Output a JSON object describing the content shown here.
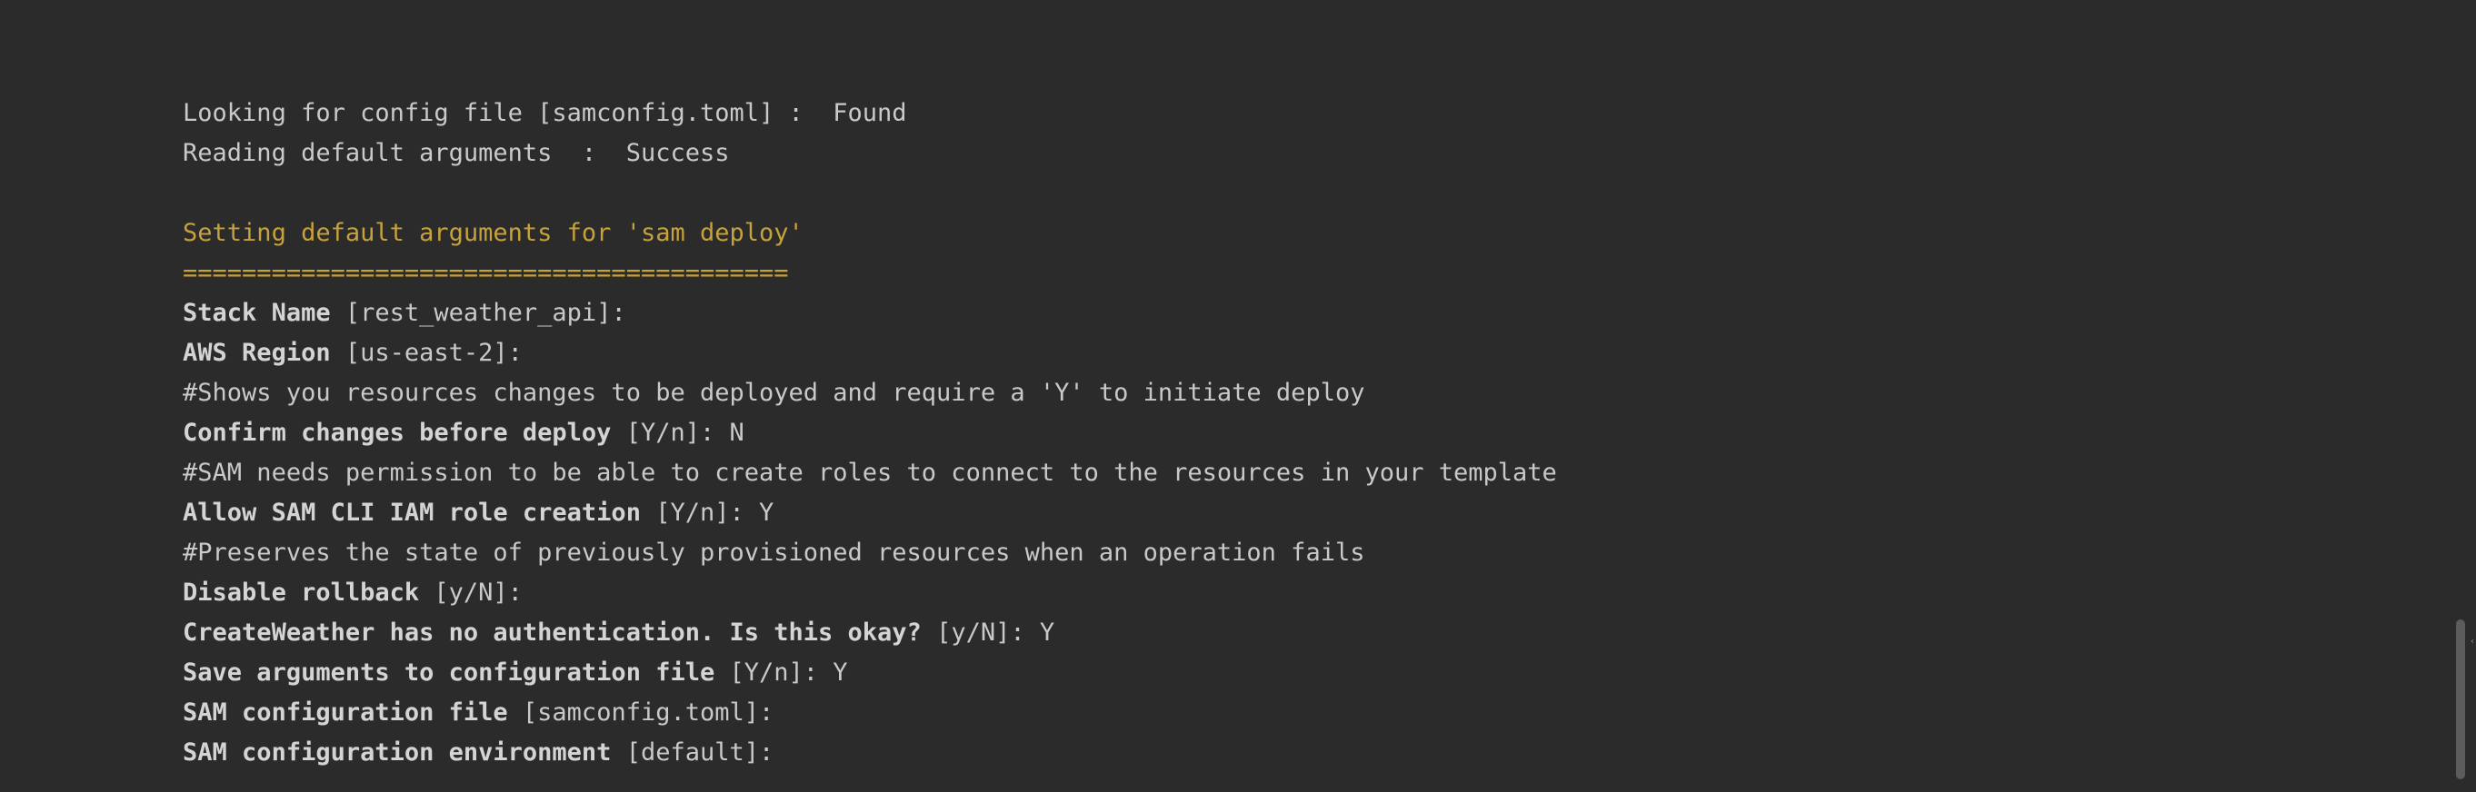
{
  "terminal": {
    "lines": [
      {
        "prompt": "",
        "rest": "Looking for config file [samconfig.toml] :  Found",
        "style": "normal"
      },
      {
        "prompt": "",
        "rest": "Reading default arguments  :  Success",
        "style": "normal"
      },
      {
        "prompt": "",
        "rest": "Setting default arguments for 'sam deploy'",
        "style": "warn"
      },
      {
        "prompt": "",
        "rest": "=========================================",
        "style": "warn"
      },
      {
        "prompt": "Stack Name",
        "rest": " [rest_weather_api]:",
        "style": "normal"
      },
      {
        "prompt": "AWS Region",
        "rest": " [us-east-2]:",
        "style": "normal"
      },
      {
        "prompt": "",
        "rest": "#Shows you resources changes to be deployed and require a 'Y' to initiate deploy",
        "style": "normal"
      },
      {
        "prompt": "Confirm changes before deploy",
        "rest": " [Y/n]: N",
        "style": "normal"
      },
      {
        "prompt": "",
        "rest": "#SAM needs permission to be able to create roles to connect to the resources in your template",
        "style": "normal"
      },
      {
        "prompt": "Allow SAM CLI IAM role creation",
        "rest": " [Y/n]: Y",
        "style": "normal"
      },
      {
        "prompt": "",
        "rest": "#Preserves the state of previously provisioned resources when an operation fails",
        "style": "normal"
      },
      {
        "prompt": "Disable rollback",
        "rest": " [y/N]:",
        "style": "normal"
      },
      {
        "prompt": "CreateWeather has no authentication. Is this okay?",
        "rest": " [y/N]: Y",
        "style": "normal"
      },
      {
        "prompt": "Save arguments to configuration file",
        "rest": " [Y/n]: Y",
        "style": "normal"
      },
      {
        "prompt": "SAM configuration file",
        "rest": " [samconfig.toml]:",
        "style": "normal"
      },
      {
        "prompt": "SAM configuration environment",
        "rest": " [default]:",
        "style": "normal"
      }
    ]
  },
  "colors": {
    "background": "#2b2b2b",
    "text": "#c9c9c9",
    "warning": "#c7a23a",
    "scrollbar_thumb": "#5c5c5c"
  },
  "icons": {
    "scroll_edge": "caret-left-icon"
  }
}
